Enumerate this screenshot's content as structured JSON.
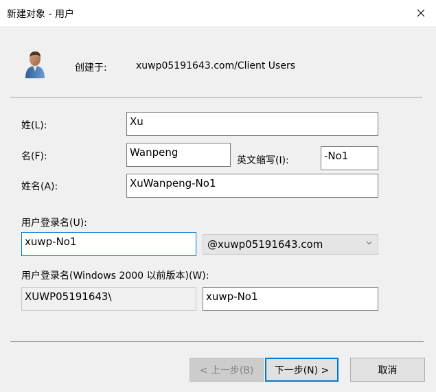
{
  "window": {
    "title": "新建对象 - 用户"
  },
  "header": {
    "icon": "user-icon",
    "created_in_label": "创建于:",
    "created_in_path": "xuwp05191643.com/Client Users"
  },
  "form": {
    "last_name_label": "姓(L):",
    "last_name_value": "Xu",
    "first_name_label": "名(F):",
    "first_name_value": "Wanpeng",
    "initials_label": "英文缩写(I):",
    "initials_value": "-No1",
    "full_name_label": "姓名(A):",
    "full_name_value": "XuWanpeng-No1",
    "logon_name_label": "用户登录名(U):",
    "logon_name_value": "xuwp-No1",
    "upn_suffix_selected": "@xuwp05191643.com",
    "pre2000_label": "用户登录名(Windows 2000 以前版本)(W):",
    "pre2000_domain": "XUWP05191643\\",
    "pre2000_value": "xuwp-No1"
  },
  "buttons": {
    "back": "< 上一步(B)",
    "next": "下一步(N) >",
    "cancel": "取消"
  },
  "colors": {
    "accent": "#0078d7",
    "background": "#f0f0f0"
  }
}
